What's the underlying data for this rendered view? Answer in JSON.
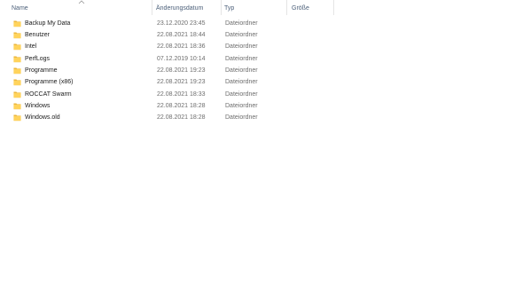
{
  "columns": {
    "name": "Name",
    "date": "Änderungsdatum",
    "type": "Typ",
    "size": "Größe"
  },
  "sort": {
    "column": "name",
    "direction": "ascending",
    "arrow_glyph": "^"
  },
  "colors": {
    "folder_fill": "#ffd35c",
    "folder_tab": "#e8b236",
    "header_text": "#4c607a",
    "secondary_text": "#6d6d6d"
  },
  "items": [
    {
      "name": "Backup My Data",
      "date": "23.12.2020 23:45",
      "type": "Dateiordner",
      "icon": "folder-icon"
    },
    {
      "name": "Benutzer",
      "date": "22.08.2021 18:44",
      "type": "Dateiordner",
      "icon": "folder-icon"
    },
    {
      "name": "Intel",
      "date": "22.08.2021 18:36",
      "type": "Dateiordner",
      "icon": "folder-icon"
    },
    {
      "name": "PerfLogs",
      "date": "07.12.2019 10:14",
      "type": "Dateiordner",
      "icon": "folder-icon"
    },
    {
      "name": "Programme",
      "date": "22.08.2021 19:23",
      "type": "Dateiordner",
      "icon": "folder-icon"
    },
    {
      "name": "Programme (x86)",
      "date": "22.08.2021 19:23",
      "type": "Dateiordner",
      "icon": "folder-icon"
    },
    {
      "name": "ROCCAT Swarm",
      "date": "22.08.2021 18:33",
      "type": "Dateiordner",
      "icon": "folder-icon"
    },
    {
      "name": "Windows",
      "date": "22.08.2021 18:28",
      "type": "Dateiordner",
      "icon": "folder-icon"
    },
    {
      "name": "Windows.old",
      "date": "22.08.2021 18:28",
      "type": "Dateiordner",
      "icon": "folder-icon"
    }
  ]
}
